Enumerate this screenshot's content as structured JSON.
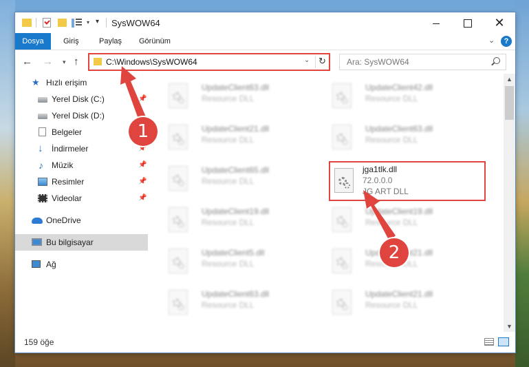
{
  "window": {
    "title": "SysWOW64",
    "controls": {
      "minimize": "minimize",
      "maximize": "maximize",
      "close": "✕"
    }
  },
  "ribbon": {
    "tabs": [
      "Dosya",
      "Giriş",
      "Paylaş",
      "Görünüm"
    ],
    "help": "?"
  },
  "navigation": {
    "address": "C:\\Windows\\SysWOW64",
    "search_placeholder": "Ara: SysWOW64"
  },
  "sidebar": {
    "items": [
      {
        "label": "Hızlı erişim",
        "icon": "star-icon"
      },
      {
        "label": "Yerel Disk (C:)",
        "icon": "disk-icon",
        "pinned": true
      },
      {
        "label": "Yerel Disk (D:)",
        "icon": "disk-icon"
      },
      {
        "label": "Belgeler",
        "icon": "documents-icon",
        "pinned": true
      },
      {
        "label": "İndirmeler",
        "icon": "downloads-icon",
        "pinned": true
      },
      {
        "label": "Müzik",
        "icon": "music-icon",
        "pinned": true
      },
      {
        "label": "Resimler",
        "icon": "pictures-icon",
        "pinned": true
      },
      {
        "label": "Videolar",
        "icon": "videos-icon",
        "pinned": true
      },
      {
        "label": "OneDrive",
        "icon": "cloud-icon"
      },
      {
        "label": "Bu bilgisayar",
        "icon": "computer-icon",
        "selected": true
      },
      {
        "label": "Ağ",
        "icon": "network-icon"
      }
    ]
  },
  "files": [
    {
      "name": "UpdateClient63.dll",
      "line2": "Resource DLL"
    },
    {
      "name": "UpdateClient42.dll",
      "line2": "Resource DLL"
    },
    {
      "name": "UpdateClient21.dll",
      "line2": "Resource DLL"
    },
    {
      "name": "UpdateClient63.dll",
      "line2": "Resource DLL"
    },
    {
      "name": "UpdateClient65.dll",
      "line2": "Resource DLL"
    },
    {
      "name": "jga1tlk.dll",
      "line2": "72.0.0.0",
      "line3": "JG ART DLL",
      "highlighted": true
    },
    {
      "name": "UpdateClient19.dll",
      "line2": "Resource DLL"
    },
    {
      "name": "UpdateClient19.dll",
      "line2": "Resource DLL"
    },
    {
      "name": "UpdateClient5.dll",
      "line2": "Resource DLL"
    },
    {
      "name": "UpdateClient21.dll",
      "line2": "Resource DLL"
    },
    {
      "name": "UpdateClient63.dll",
      "line2": "Resource DLL"
    },
    {
      "name": "UpdateClient21.dll",
      "line2": "Resource DLL"
    }
  ],
  "status": {
    "item_count": "159 öğe"
  },
  "annotations": {
    "badge_1": "1",
    "badge_2": "2",
    "color": "#e0443e"
  },
  "colors": {
    "accent": "#1979ca",
    "highlight": "#e0443e",
    "selection": "#d9d9d9"
  }
}
